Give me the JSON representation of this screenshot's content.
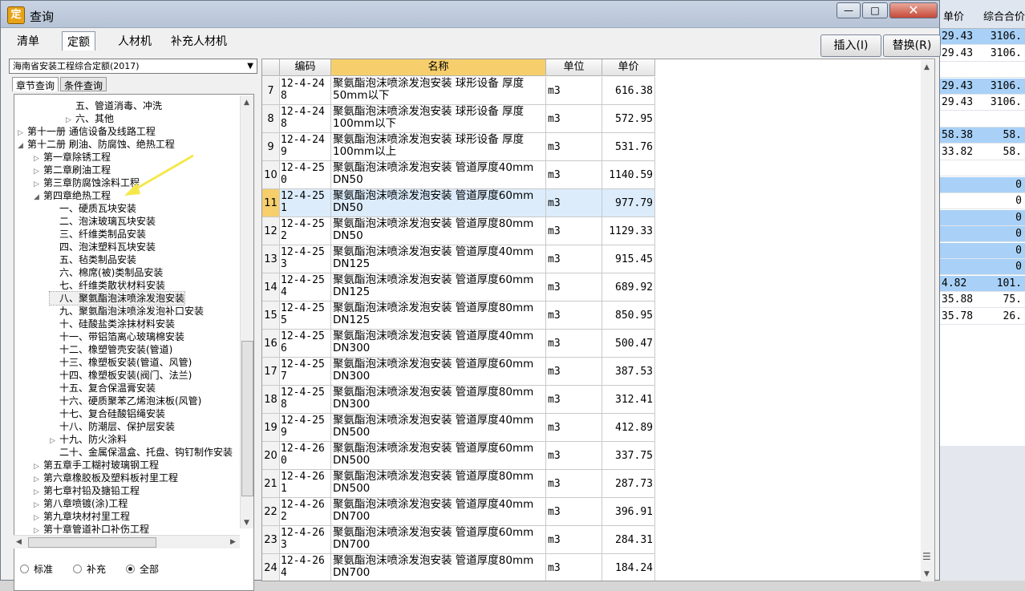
{
  "background": {
    "headers": [
      "单价",
      "综合合价"
    ],
    "rows": [
      {
        "a": "29.43",
        "b": "3106.",
        "hl": true
      },
      {
        "a": "29.43",
        "b": "3106.",
        "hl": false
      },
      {
        "a": "",
        "b": "",
        "hl": false
      },
      {
        "a": "29.43",
        "b": "3106.",
        "hl": true
      },
      {
        "a": "29.43",
        "b": "3106.",
        "hl": false
      },
      {
        "a": "",
        "b": "",
        "hl": false
      },
      {
        "a": "58.38",
        "b": "58.",
        "hl": true
      },
      {
        "a": "33.82",
        "b": "58.",
        "hl": false
      },
      {
        "a": "",
        "b": "",
        "hl": false
      },
      {
        "a": "",
        "b": "0",
        "hl": true
      },
      {
        "a": "",
        "b": "0",
        "hl": false
      },
      {
        "a": "",
        "b": "0",
        "hl": true
      },
      {
        "a": "",
        "b": "0",
        "hl": true
      },
      {
        "a": "",
        "b": "0",
        "hl": true
      },
      {
        "a": "",
        "b": "0",
        "hl": true
      },
      {
        "a": "4.82",
        "b": "101.",
        "hl": true
      },
      {
        "a": "35.88",
        "b": "75.",
        "hl": false
      },
      {
        "a": "35.78",
        "b": "26.",
        "hl": false
      }
    ]
  },
  "window": {
    "title": "查询",
    "icon": "app-icon",
    "minimize": "—",
    "maximize": "□",
    "close": "✕"
  },
  "tabs": [
    "清单",
    "定额",
    "人材机",
    "补充人材机"
  ],
  "active_tab": 1,
  "buttons": {
    "insert": "插入(I)",
    "replace": "替换(R)"
  },
  "quota_select": "海南省安装工程综合定额(2017)",
  "subtabs": [
    "章节查询",
    "条件查询"
  ],
  "tree": [
    {
      "label": "五、管道消毒、冲洗",
      "level": 3,
      "toggle": ""
    },
    {
      "label": "六、其他",
      "level": 3,
      "toggle": "▷"
    },
    {
      "label": "第十一册 通信设备及线路工程",
      "level": 0,
      "toggle": "▷"
    },
    {
      "label": "第十二册 刷油、防腐蚀、绝热工程",
      "level": 0,
      "toggle": "◢"
    },
    {
      "label": "第一章除锈工程",
      "level": 1,
      "toggle": "▷"
    },
    {
      "label": "第二章刷油工程",
      "level": 1,
      "toggle": "▷"
    },
    {
      "label": "第三章防腐蚀涂料工程",
      "level": 1,
      "toggle": "▷"
    },
    {
      "label": "第四章绝热工程",
      "level": 1,
      "toggle": "◢"
    },
    {
      "label": "一、硬质瓦块安装",
      "level": 2,
      "toggle": ""
    },
    {
      "label": "二、泡沫玻璃瓦块安装",
      "level": 2,
      "toggle": ""
    },
    {
      "label": "三、纤维类制品安装",
      "level": 2,
      "toggle": ""
    },
    {
      "label": "四、泡沫塑料瓦块安装",
      "level": 2,
      "toggle": ""
    },
    {
      "label": "五、毡类制品安装",
      "level": 2,
      "toggle": ""
    },
    {
      "label": "六、棉席(被)类制品安装",
      "level": 2,
      "toggle": ""
    },
    {
      "label": "七、纤维类散状材料安装",
      "level": 2,
      "toggle": ""
    },
    {
      "label": "八、聚氨酯泡沫喷涂发泡安装",
      "level": 2,
      "toggle": "",
      "sel": true
    },
    {
      "label": "九、聚氨酯泡沫喷涂发泡补口安装",
      "level": 2,
      "toggle": ""
    },
    {
      "label": "十、硅酸盐类涂抹材料安装",
      "level": 2,
      "toggle": ""
    },
    {
      "label": "十一、带铝箔离心玻璃棉安装",
      "level": 2,
      "toggle": ""
    },
    {
      "label": "十二、橡塑管壳安装(管道)",
      "level": 2,
      "toggle": ""
    },
    {
      "label": "十三、橡塑板安装(管道、风管)",
      "level": 2,
      "toggle": ""
    },
    {
      "label": "十四、橡塑板安装(阀门、法兰)",
      "level": 2,
      "toggle": ""
    },
    {
      "label": "十五、复合保温膏安装",
      "level": 2,
      "toggle": ""
    },
    {
      "label": "十六、硬质聚苯乙烯泡沫板(风管)",
      "level": 2,
      "toggle": ""
    },
    {
      "label": "十七、复合硅酸铝绳安装",
      "level": 2,
      "toggle": ""
    },
    {
      "label": "十八、防潮层、保护层安装",
      "level": 2,
      "toggle": ""
    },
    {
      "label": "十九、防火涂料",
      "level": 2,
      "toggle": "▷"
    },
    {
      "label": "二十、金属保温盒、托盘、钩钉制作安装",
      "level": 2,
      "toggle": ""
    },
    {
      "label": "第五章手工糊衬玻璃钢工程",
      "level": 1,
      "toggle": "▷"
    },
    {
      "label": "第六章橡胶板及塑料板衬里工程",
      "level": 1,
      "toggle": "▷"
    },
    {
      "label": "第七章衬铅及搪铅工程",
      "level": 1,
      "toggle": "▷"
    },
    {
      "label": "第八章喷镀(涂)工程",
      "level": 1,
      "toggle": "▷"
    },
    {
      "label": "第九章块材衬里工程",
      "level": 1,
      "toggle": "▷"
    },
    {
      "label": "第十章管道补口补伤工程",
      "level": 1,
      "toggle": "▷"
    }
  ],
  "radios": {
    "options": [
      "标准",
      "补充",
      "全部"
    ],
    "selected": 2
  },
  "grid": {
    "headers": {
      "code": "编码",
      "name": "名称",
      "unit": "单位",
      "price": "单价"
    },
    "rows": [
      {
        "n": "7",
        "code": "12-4-248",
        "name": "聚氨酯泡沫喷涂发泡安装 球形设备 厚度50mm以下",
        "unit": "m3",
        "price": "616.38"
      },
      {
        "n": "8",
        "code": "12-4-248",
        "name": "聚氨酯泡沫喷涂发泡安装 球形设备 厚度100mm以下",
        "unit": "m3",
        "price": "572.95"
      },
      {
        "n": "9",
        "code": "12-4-249",
        "name": "聚氨酯泡沫喷涂发泡安装 球形设备 厚度100mm以上",
        "unit": "m3",
        "price": "531.76"
      },
      {
        "n": "10",
        "code": "12-4-250",
        "name": "聚氨酯泡沫喷涂发泡安装 管道厚度40mm DN50",
        "unit": "m3",
        "price": "1140.59"
      },
      {
        "n": "11",
        "code": "12-4-251",
        "name": "聚氨酯泡沫喷涂发泡安装 管道厚度60mm DN50",
        "unit": "m3",
        "price": "977.79",
        "sel": true
      },
      {
        "n": "12",
        "code": "12-4-252",
        "name": "聚氨酯泡沫喷涂发泡安装 管道厚度80mm DN50",
        "unit": "m3",
        "price": "1129.33"
      },
      {
        "n": "13",
        "code": "12-4-253",
        "name": "聚氨酯泡沫喷涂发泡安装 管道厚度40mm DN125",
        "unit": "m3",
        "price": "915.45"
      },
      {
        "n": "14",
        "code": "12-4-254",
        "name": "聚氨酯泡沫喷涂发泡安装 管道厚度60mm DN125",
        "unit": "m3",
        "price": "689.92"
      },
      {
        "n": "15",
        "code": "12-4-255",
        "name": "聚氨酯泡沫喷涂发泡安装 管道厚度80mm DN125",
        "unit": "m3",
        "price": "850.95"
      },
      {
        "n": "16",
        "code": "12-4-256",
        "name": "聚氨酯泡沫喷涂发泡安装 管道厚度40mm DN300",
        "unit": "m3",
        "price": "500.47"
      },
      {
        "n": "17",
        "code": "12-4-257",
        "name": "聚氨酯泡沫喷涂发泡安装 管道厚度60mm DN300",
        "unit": "m3",
        "price": "387.53"
      },
      {
        "n": "18",
        "code": "12-4-258",
        "name": "聚氨酯泡沫喷涂发泡安装 管道厚度80mm DN300",
        "unit": "m3",
        "price": "312.41"
      },
      {
        "n": "19",
        "code": "12-4-259",
        "name": "聚氨酯泡沫喷涂发泡安装 管道厚度40mm DN500",
        "unit": "m3",
        "price": "412.89"
      },
      {
        "n": "20",
        "code": "12-4-260",
        "name": "聚氨酯泡沫喷涂发泡安装 管道厚度60mm DN500",
        "unit": "m3",
        "price": "337.75"
      },
      {
        "n": "21",
        "code": "12-4-261",
        "name": "聚氨酯泡沫喷涂发泡安装 管道厚度80mm DN500",
        "unit": "m3",
        "price": "287.73"
      },
      {
        "n": "22",
        "code": "12-4-262",
        "name": "聚氨酯泡沫喷涂发泡安装 管道厚度40mm DN700",
        "unit": "m3",
        "price": "396.91"
      },
      {
        "n": "23",
        "code": "12-4-263",
        "name": "聚氨酯泡沫喷涂发泡安装 管道厚度60mm DN700",
        "unit": "m3",
        "price": "284.31"
      },
      {
        "n": "24",
        "code": "12-4-264",
        "name": "聚氨酯泡沫喷涂发泡安装 管道厚度80mm DN700",
        "unit": "m3",
        "price": "184.24"
      }
    ]
  },
  "colors": {
    "accent": "#f6cf6c",
    "selection": "#dcecfb",
    "bg_highlight": "#a9d1f7",
    "arrow": "#f5e84a"
  }
}
